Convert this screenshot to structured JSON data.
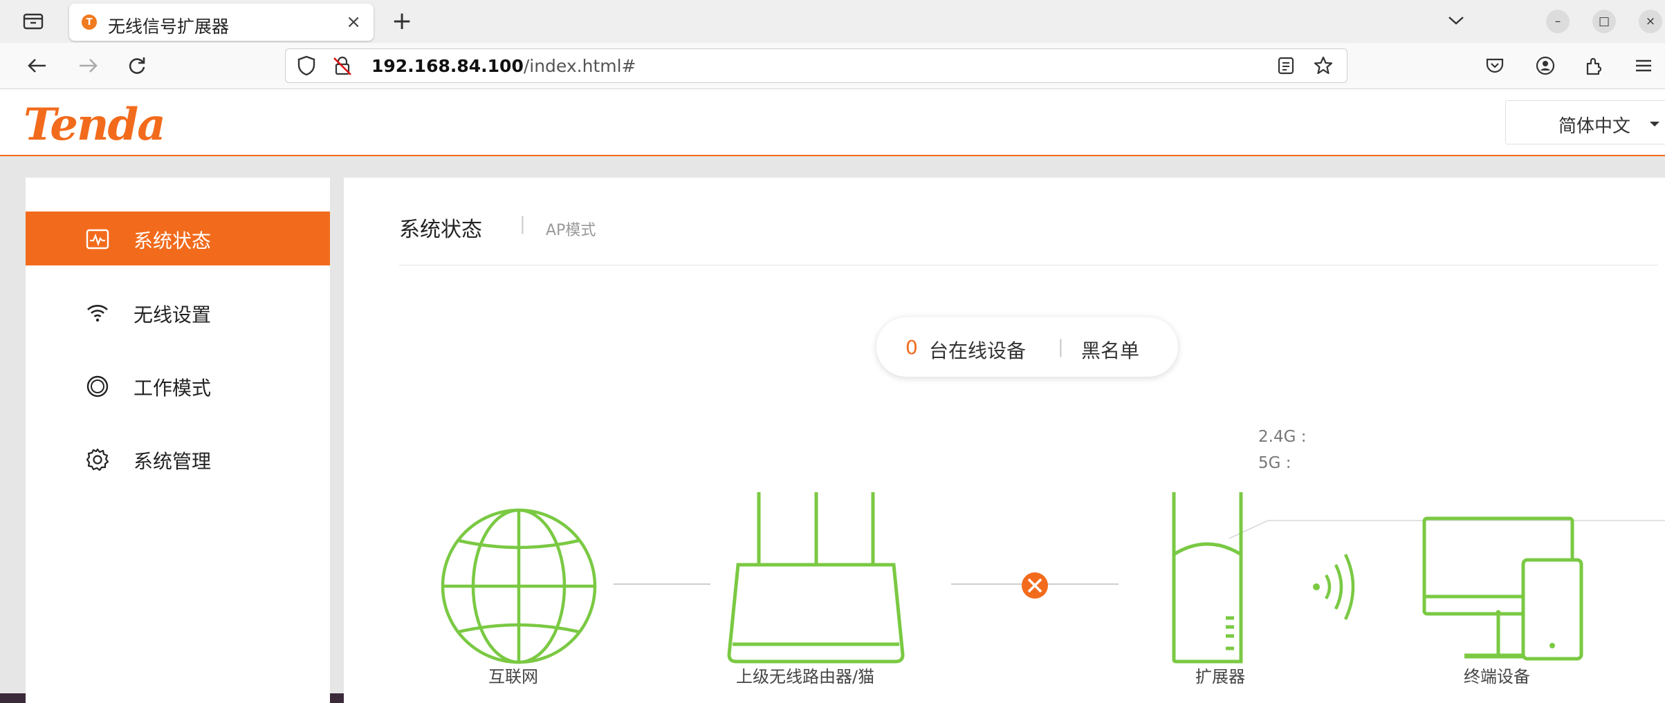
{
  "browser": {
    "tab_title": "无线信号扩展器",
    "tab_close": "×",
    "new_tab": "+",
    "url_host": "192.168.84.100",
    "url_path": "/index.html#",
    "window_controls": [
      "–",
      "□",
      "×"
    ]
  },
  "header": {
    "logo": "Tenda",
    "language": "简体中文"
  },
  "sidebar": {
    "items": [
      {
        "label": "系统状态",
        "icon": "status-icon",
        "active": true
      },
      {
        "label": "无线设置",
        "icon": "wifi-icon",
        "active": false
      },
      {
        "label": "工作模式",
        "icon": "mode-icon",
        "active": false
      },
      {
        "label": "系统管理",
        "icon": "gear-icon",
        "active": false
      }
    ]
  },
  "content": {
    "title": "系统状态",
    "separator": "|",
    "mode": "AP模式",
    "online_count": "0",
    "online_label": "台在线设备",
    "pill_separator": "|",
    "blacklist": "黑名单",
    "band_24": "2.4G :",
    "band_5": "5G :",
    "topology": {
      "internet": "互联网",
      "router": "上级无线路由器/猫",
      "extender": "扩展器",
      "terminal": "终端设备"
    }
  },
  "colors": {
    "accent": "#f26b1c",
    "device_green": "#7ac943",
    "error": "#f26b1c"
  }
}
